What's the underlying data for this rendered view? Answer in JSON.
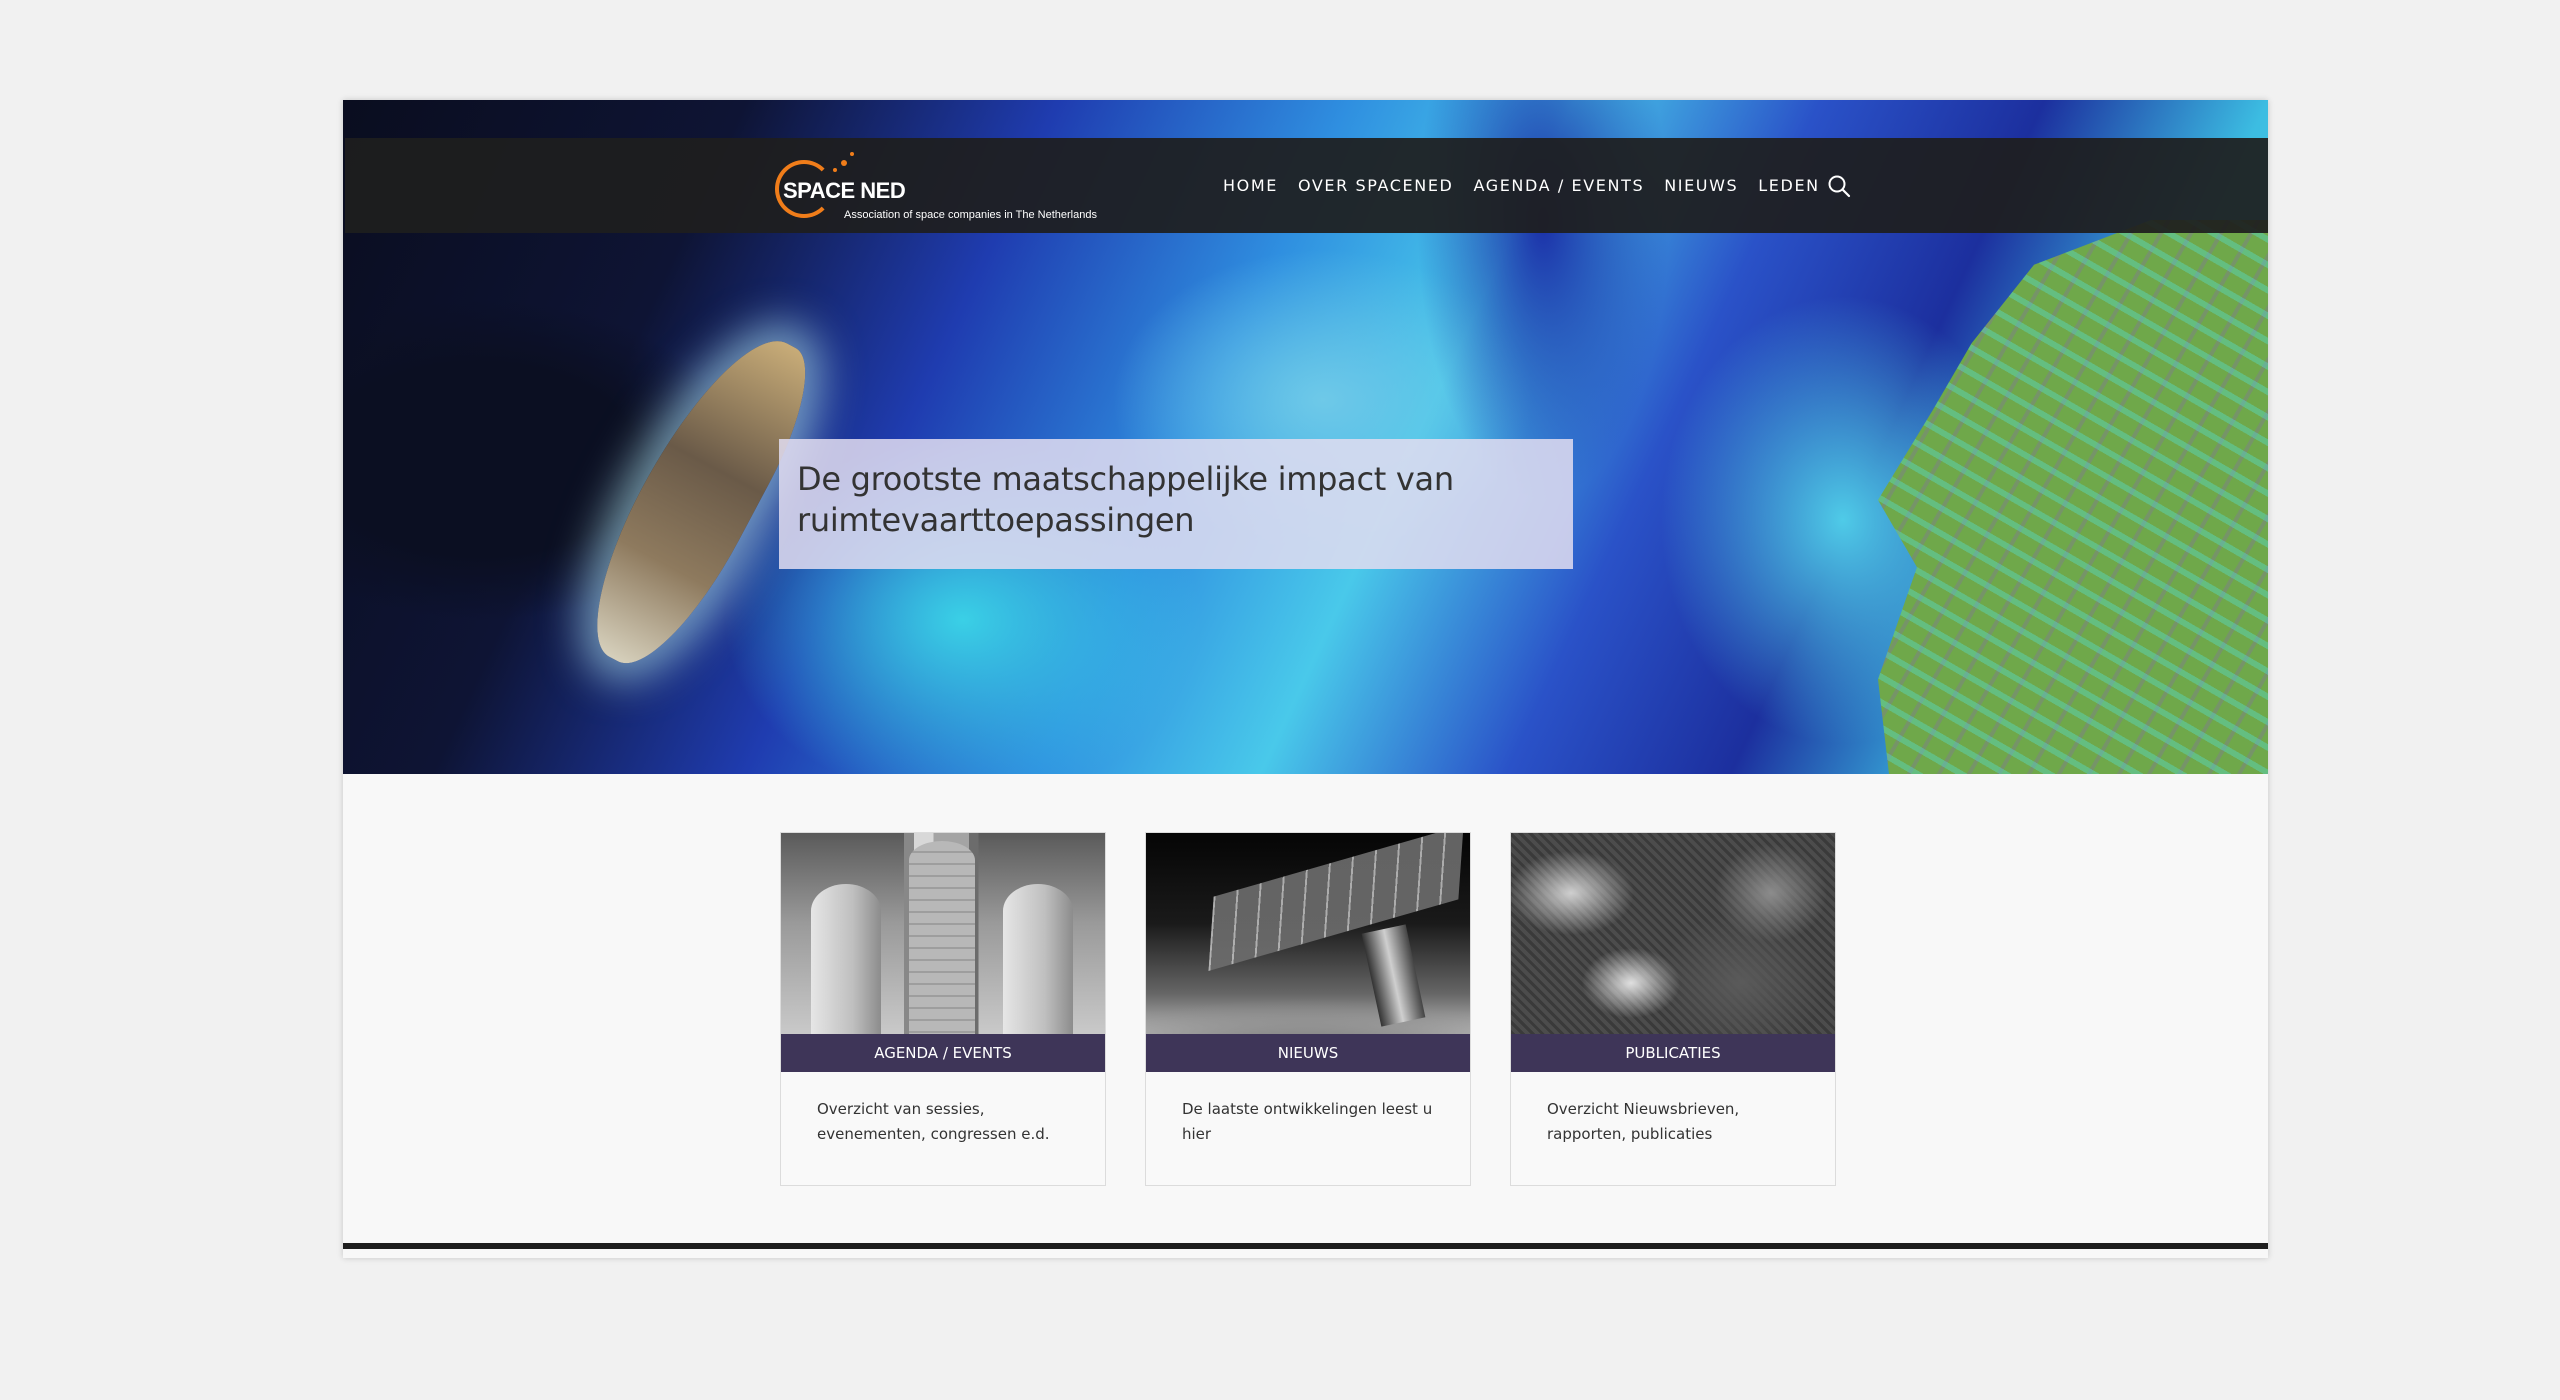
{
  "header": {
    "logo_word": "SPACE NED",
    "logo_tagline": "Association of space companies in The Netherlands",
    "nav": [
      "HOME",
      "OVER SPACENED",
      "AGENDA / EVENTS",
      "NIEUWS",
      "LEDEN"
    ],
    "search_icon": "search-icon"
  },
  "hero": {
    "caption": "De grootste maatschappelijke impact van ruimtevaarttoepassingen"
  },
  "cards": [
    {
      "label": "AGENDA / EVENTS",
      "text": "Overzicht van sessies, evenementen, congressen e.d."
    },
    {
      "label": "NIEUWS",
      "text": "De laatste ontwikkelingen leest u hier"
    },
    {
      "label": "PUBLICATIES",
      "text": "Overzicht Nieuwsbrieven, rapporten, publicaties"
    }
  ],
  "colors": {
    "brand_orange": "#f07d1a",
    "card_label_bg": "#3e3558",
    "navbar_bg": "#1e1e1e"
  }
}
